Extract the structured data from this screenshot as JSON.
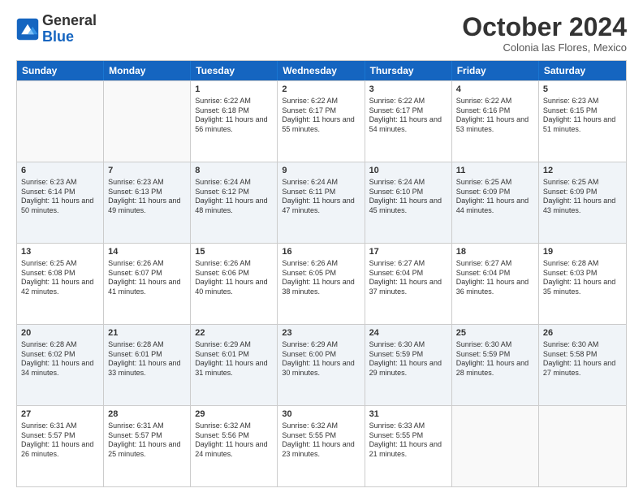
{
  "logo": {
    "general": "General",
    "blue": "Blue"
  },
  "header": {
    "month": "October 2024",
    "location": "Colonia las Flores, Mexico"
  },
  "days": [
    "Sunday",
    "Monday",
    "Tuesday",
    "Wednesday",
    "Thursday",
    "Friday",
    "Saturday"
  ],
  "rows": [
    [
      {
        "day": "",
        "sunrise": "",
        "sunset": "",
        "daylight": "",
        "empty": true
      },
      {
        "day": "",
        "sunrise": "",
        "sunset": "",
        "daylight": "",
        "empty": true
      },
      {
        "day": "1",
        "sunrise": "Sunrise: 6:22 AM",
        "sunset": "Sunset: 6:18 PM",
        "daylight": "Daylight: 11 hours and 56 minutes.",
        "empty": false
      },
      {
        "day": "2",
        "sunrise": "Sunrise: 6:22 AM",
        "sunset": "Sunset: 6:17 PM",
        "daylight": "Daylight: 11 hours and 55 minutes.",
        "empty": false
      },
      {
        "day": "3",
        "sunrise": "Sunrise: 6:22 AM",
        "sunset": "Sunset: 6:17 PM",
        "daylight": "Daylight: 11 hours and 54 minutes.",
        "empty": false
      },
      {
        "day": "4",
        "sunrise": "Sunrise: 6:22 AM",
        "sunset": "Sunset: 6:16 PM",
        "daylight": "Daylight: 11 hours and 53 minutes.",
        "empty": false
      },
      {
        "day": "5",
        "sunrise": "Sunrise: 6:23 AM",
        "sunset": "Sunset: 6:15 PM",
        "daylight": "Daylight: 11 hours and 51 minutes.",
        "empty": false
      }
    ],
    [
      {
        "day": "6",
        "sunrise": "Sunrise: 6:23 AM",
        "sunset": "Sunset: 6:14 PM",
        "daylight": "Daylight: 11 hours and 50 minutes.",
        "empty": false
      },
      {
        "day": "7",
        "sunrise": "Sunrise: 6:23 AM",
        "sunset": "Sunset: 6:13 PM",
        "daylight": "Daylight: 11 hours and 49 minutes.",
        "empty": false
      },
      {
        "day": "8",
        "sunrise": "Sunrise: 6:24 AM",
        "sunset": "Sunset: 6:12 PM",
        "daylight": "Daylight: 11 hours and 48 minutes.",
        "empty": false
      },
      {
        "day": "9",
        "sunrise": "Sunrise: 6:24 AM",
        "sunset": "Sunset: 6:11 PM",
        "daylight": "Daylight: 11 hours and 47 minutes.",
        "empty": false
      },
      {
        "day": "10",
        "sunrise": "Sunrise: 6:24 AM",
        "sunset": "Sunset: 6:10 PM",
        "daylight": "Daylight: 11 hours and 45 minutes.",
        "empty": false
      },
      {
        "day": "11",
        "sunrise": "Sunrise: 6:25 AM",
        "sunset": "Sunset: 6:09 PM",
        "daylight": "Daylight: 11 hours and 44 minutes.",
        "empty": false
      },
      {
        "day": "12",
        "sunrise": "Sunrise: 6:25 AM",
        "sunset": "Sunset: 6:09 PM",
        "daylight": "Daylight: 11 hours and 43 minutes.",
        "empty": false
      }
    ],
    [
      {
        "day": "13",
        "sunrise": "Sunrise: 6:25 AM",
        "sunset": "Sunset: 6:08 PM",
        "daylight": "Daylight: 11 hours and 42 minutes.",
        "empty": false
      },
      {
        "day": "14",
        "sunrise": "Sunrise: 6:26 AM",
        "sunset": "Sunset: 6:07 PM",
        "daylight": "Daylight: 11 hours and 41 minutes.",
        "empty": false
      },
      {
        "day": "15",
        "sunrise": "Sunrise: 6:26 AM",
        "sunset": "Sunset: 6:06 PM",
        "daylight": "Daylight: 11 hours and 40 minutes.",
        "empty": false
      },
      {
        "day": "16",
        "sunrise": "Sunrise: 6:26 AM",
        "sunset": "Sunset: 6:05 PM",
        "daylight": "Daylight: 11 hours and 38 minutes.",
        "empty": false
      },
      {
        "day": "17",
        "sunrise": "Sunrise: 6:27 AM",
        "sunset": "Sunset: 6:04 PM",
        "daylight": "Daylight: 11 hours and 37 minutes.",
        "empty": false
      },
      {
        "day": "18",
        "sunrise": "Sunrise: 6:27 AM",
        "sunset": "Sunset: 6:04 PM",
        "daylight": "Daylight: 11 hours and 36 minutes.",
        "empty": false
      },
      {
        "day": "19",
        "sunrise": "Sunrise: 6:28 AM",
        "sunset": "Sunset: 6:03 PM",
        "daylight": "Daylight: 11 hours and 35 minutes.",
        "empty": false
      }
    ],
    [
      {
        "day": "20",
        "sunrise": "Sunrise: 6:28 AM",
        "sunset": "Sunset: 6:02 PM",
        "daylight": "Daylight: 11 hours and 34 minutes.",
        "empty": false
      },
      {
        "day": "21",
        "sunrise": "Sunrise: 6:28 AM",
        "sunset": "Sunset: 6:01 PM",
        "daylight": "Daylight: 11 hours and 33 minutes.",
        "empty": false
      },
      {
        "day": "22",
        "sunrise": "Sunrise: 6:29 AM",
        "sunset": "Sunset: 6:01 PM",
        "daylight": "Daylight: 11 hours and 31 minutes.",
        "empty": false
      },
      {
        "day": "23",
        "sunrise": "Sunrise: 6:29 AM",
        "sunset": "Sunset: 6:00 PM",
        "daylight": "Daylight: 11 hours and 30 minutes.",
        "empty": false
      },
      {
        "day": "24",
        "sunrise": "Sunrise: 6:30 AM",
        "sunset": "Sunset: 5:59 PM",
        "daylight": "Daylight: 11 hours and 29 minutes.",
        "empty": false
      },
      {
        "day": "25",
        "sunrise": "Sunrise: 6:30 AM",
        "sunset": "Sunset: 5:59 PM",
        "daylight": "Daylight: 11 hours and 28 minutes.",
        "empty": false
      },
      {
        "day": "26",
        "sunrise": "Sunrise: 6:30 AM",
        "sunset": "Sunset: 5:58 PM",
        "daylight": "Daylight: 11 hours and 27 minutes.",
        "empty": false
      }
    ],
    [
      {
        "day": "27",
        "sunrise": "Sunrise: 6:31 AM",
        "sunset": "Sunset: 5:57 PM",
        "daylight": "Daylight: 11 hours and 26 minutes.",
        "empty": false
      },
      {
        "day": "28",
        "sunrise": "Sunrise: 6:31 AM",
        "sunset": "Sunset: 5:57 PM",
        "daylight": "Daylight: 11 hours and 25 minutes.",
        "empty": false
      },
      {
        "day": "29",
        "sunrise": "Sunrise: 6:32 AM",
        "sunset": "Sunset: 5:56 PM",
        "daylight": "Daylight: 11 hours and 24 minutes.",
        "empty": false
      },
      {
        "day": "30",
        "sunrise": "Sunrise: 6:32 AM",
        "sunset": "Sunset: 5:55 PM",
        "daylight": "Daylight: 11 hours and 23 minutes.",
        "empty": false
      },
      {
        "day": "31",
        "sunrise": "Sunrise: 6:33 AM",
        "sunset": "Sunset: 5:55 PM",
        "daylight": "Daylight: 11 hours and 21 minutes.",
        "empty": false
      },
      {
        "day": "",
        "sunrise": "",
        "sunset": "",
        "daylight": "",
        "empty": true
      },
      {
        "day": "",
        "sunrise": "",
        "sunset": "",
        "daylight": "",
        "empty": true
      }
    ]
  ]
}
